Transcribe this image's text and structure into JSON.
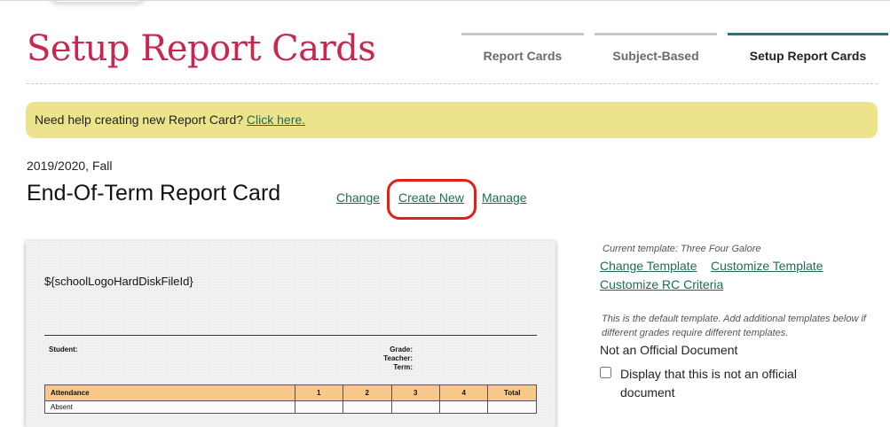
{
  "page": {
    "title": "Setup Report Cards",
    "title_color": "#c8284f",
    "accent_color": "#2a7083",
    "link_color": "#1e6b5c"
  },
  "tabs": [
    {
      "label": "Report Cards",
      "active": false
    },
    {
      "label": "Subject-Based",
      "active": false
    },
    {
      "label": "Setup Report Cards",
      "active": true
    }
  ],
  "help_banner": {
    "text": "Need help creating new Report Card?",
    "link": "Click here.",
    "background": "#ece48a"
  },
  "report_card": {
    "term": "2019/2020, Fall",
    "title": "End-Of-Term Report Card",
    "change_link": "Change",
    "create_new_link": "Create New",
    "manage_link": "Manage",
    "highlight_color": "#e0201b"
  },
  "preview": {
    "logo_placeholder": "${schoolLogoHardDiskFileId}",
    "student_label": "Student:",
    "grade_label": "Grade:",
    "teacher_label": "Teacher:",
    "term_label": "Term:",
    "table": {
      "headers": [
        "Attendance",
        "1",
        "2",
        "3",
        "4",
        "Total"
      ],
      "rows": [
        [
          "Absent",
          "",
          "",
          "",
          "",
          ""
        ]
      ],
      "header_color": "#f8c88a"
    }
  },
  "sidebar": {
    "current_template": "Current template: Three Four Galore",
    "change_template": "Change Template",
    "customize_template": "Customize Template",
    "customize_criteria": "Customize RC Criteria",
    "default_note": "This is the default template. Add additional templates below if different grades require different templates.",
    "official_heading": "Not an Official Document",
    "official_checkbox_label": "Display that this is not an official document",
    "official_checked": false
  }
}
